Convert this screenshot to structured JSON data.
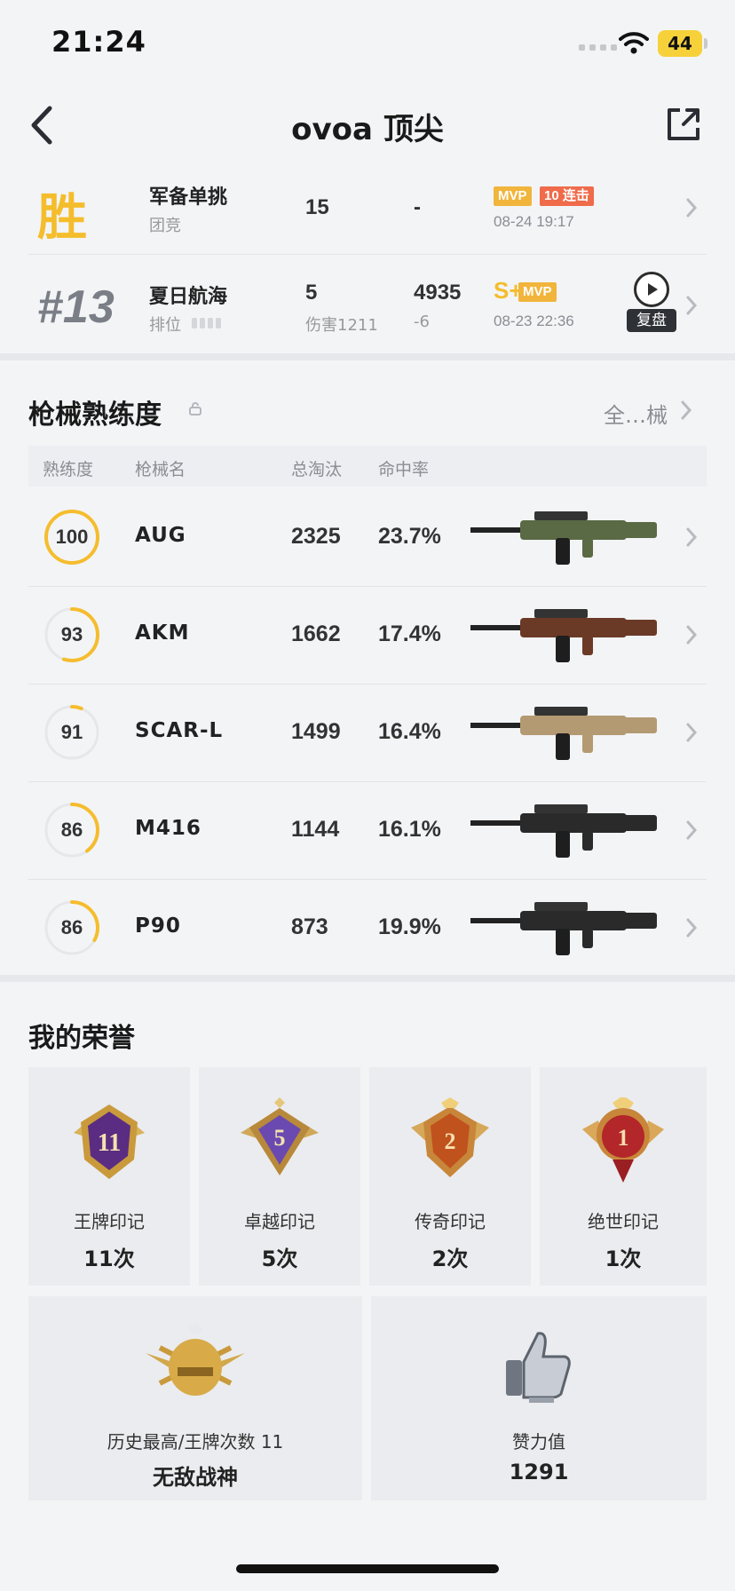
{
  "status_bar": {
    "time": "21:24",
    "battery": "44"
  },
  "header": {
    "title": "ovoa 顶尖"
  },
  "matches": [
    {
      "result": "胜",
      "mode": "军备单挑",
      "sub": "团竞",
      "stat1": "15",
      "stat1_sub": "",
      "stat2": "-",
      "stat2_sub": "",
      "badges": [
        "MVP",
        "10 连击"
      ],
      "date": "08-24 19:17"
    },
    {
      "result": "#13",
      "mode": "夏日航海",
      "sub": "排位",
      "stat1": "5",
      "stat1_sub": "伤害1211",
      "stat2": "4935",
      "stat2_sub": "-6",
      "grade": "S+",
      "badges": [
        "MVP"
      ],
      "date": "08-23 22:36",
      "replay_label": "复盘"
    }
  ],
  "weapon_section": {
    "title": "枪械熟练度",
    "see_all": "全…械",
    "columns": [
      "熟练度",
      "枪械名",
      "总淘汰",
      "命中率"
    ],
    "accent_color": "#f5bd2e",
    "rows": [
      {
        "proficiency": "100",
        "progress": 1.0,
        "name": "AUG",
        "kills": "2325",
        "accuracy": "23.7%"
      },
      {
        "proficiency": "93",
        "progress": 0.55,
        "name": "AKM",
        "kills": "1662",
        "accuracy": "17.4%"
      },
      {
        "proficiency": "91",
        "progress": 0.06,
        "name": "SCAR-L",
        "kills": "1499",
        "accuracy": "16.4%"
      },
      {
        "proficiency": "86",
        "progress": 0.4,
        "name": "M416",
        "kills": "1144",
        "accuracy": "16.1%"
      },
      {
        "proficiency": "86",
        "progress": 0.33,
        "name": "P90",
        "kills": "873",
        "accuracy": "19.9%"
      }
    ]
  },
  "honor_section": {
    "title": "我的荣誉",
    "badges": [
      {
        "label": "王牌印记",
        "count": "11次",
        "medal_number": "11"
      },
      {
        "label": "卓越印记",
        "count": "5次",
        "medal_number": "5"
      },
      {
        "label": "传奇印记",
        "count": "2次",
        "medal_number": "2"
      },
      {
        "label": "绝世印记",
        "count": "1次",
        "medal_number": "1"
      }
    ],
    "highest": {
      "label": "历史最高/王牌次数 11",
      "value": "无敌战神"
    },
    "likes": {
      "label": "赞力值",
      "value": "1291"
    }
  }
}
